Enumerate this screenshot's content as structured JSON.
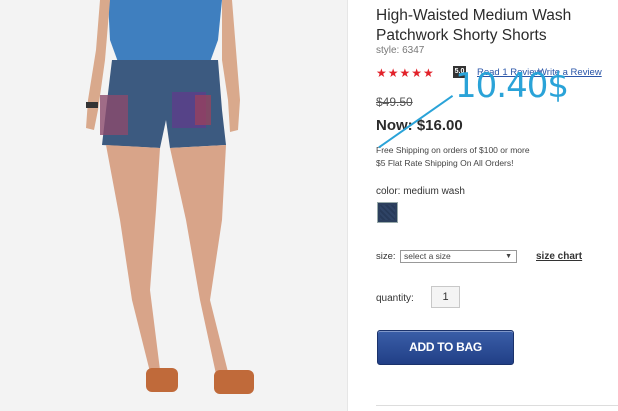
{
  "product": {
    "title": "High-Waisted Medium Wash Patchwork Shorty Shorts",
    "style": "style: 6347",
    "rating_stars": "★★★★★",
    "rating_badge": "5.0",
    "read_review": "Read 1 Review",
    "write_review": "Write a Review",
    "old_price": "$49.50",
    "now_price": "Now: $16.00",
    "shipping_line1": "Free Shipping on orders of $100 or more",
    "shipping_line2": "$5 Flat Rate Shipping On All Orders!",
    "color_label": "color: medium wash",
    "size_label": "size:",
    "size_select_value": "select a size",
    "size_chart": "size chart",
    "quantity_label": "quantity:",
    "quantity_value": "1",
    "add_to_bag": "ADD TO BAG"
  },
  "annotation": {
    "text": "10.40$",
    "color": "#2aa3d8"
  },
  "colors": {
    "accent_blue": "#2a55a8",
    "button_blue": "#2a4a92",
    "star_red": "#e2222a",
    "swatch": "#2c3f5d"
  },
  "icons": [
    "star-icon",
    "dropdown-arrow-icon"
  ]
}
